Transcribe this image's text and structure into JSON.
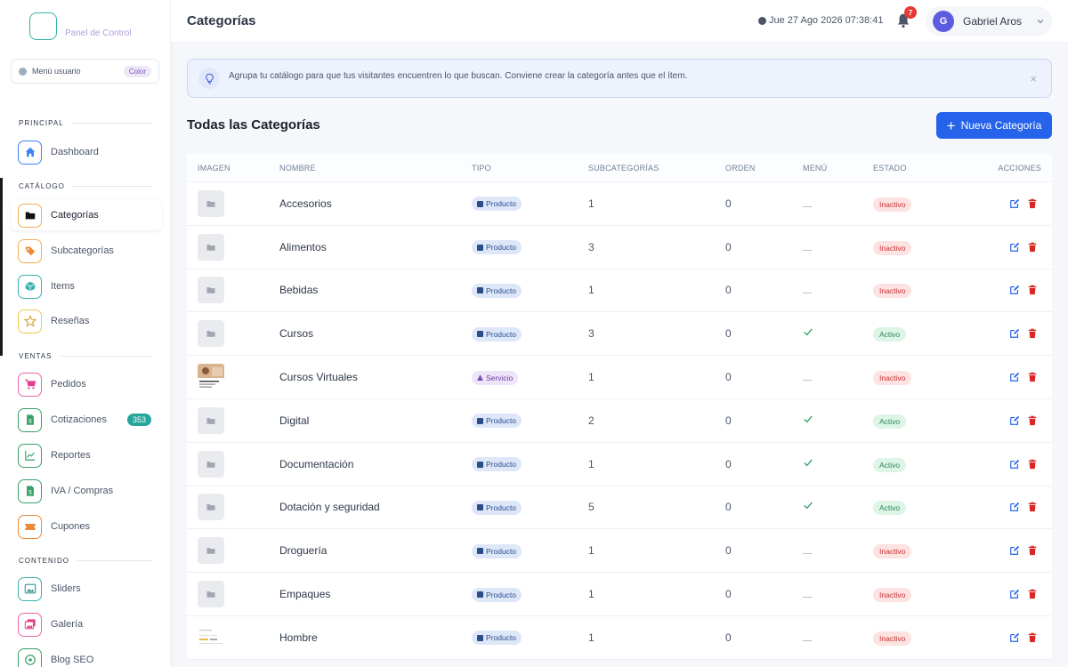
{
  "sidebar": {
    "logo_text": "Panel de Control",
    "menu_user": {
      "label": "Menú usuario",
      "color_badge": "Color"
    },
    "sections": [
      {
        "title": "PRINCIPAL",
        "items": [
          {
            "label": "Dashboard",
            "icon": "home-icon"
          }
        ]
      },
      {
        "title": "CATÁLOGO",
        "items": [
          {
            "label": "Categorías",
            "icon": "folder-icon",
            "active": true
          },
          {
            "label": "Subcategorías",
            "icon": "tags-icon"
          },
          {
            "label": "Items",
            "icon": "cube-icon"
          },
          {
            "label": "Reseñas",
            "icon": "star-icon"
          }
        ]
      },
      {
        "title": "VENTAS",
        "items": [
          {
            "label": "Pedidos",
            "icon": "cart-icon"
          },
          {
            "label": "Cotizaciones",
            "icon": "invoice-icon",
            "badge": "353"
          },
          {
            "label": "Reportes",
            "icon": "chart-line-icon"
          },
          {
            "label": "IVA / Compras",
            "icon": "receipt-icon"
          },
          {
            "label": "Cupones",
            "icon": "ticket-icon"
          }
        ]
      },
      {
        "title": "CONTENIDO",
        "items": [
          {
            "label": "Sliders",
            "icon": "image-icon"
          },
          {
            "label": "Galería",
            "icon": "images-icon"
          },
          {
            "label": "Blog SEO",
            "icon": "blog-icon"
          }
        ]
      }
    ]
  },
  "header": {
    "title": "Categorías",
    "datetime": "Jue 27 Ago 2026 07:38:41",
    "notifications": "7",
    "user": {
      "initial": "G",
      "name": "Gabriel Aros"
    }
  },
  "alert": {
    "text": "Agrupa tu catálogo para que tus visitantes encuentren lo que buscan. Conviene crear la categoría antes que el ítem.",
    "close": "×"
  },
  "content": {
    "heading": "Todas las Categorías",
    "new_button": "Nueva Categoría"
  },
  "table": {
    "columns": [
      "IMAGEN",
      "NOMBRE",
      "TIPO",
      "SUBCATEGORÍAS",
      "ORDEN",
      "MENÚ",
      "ESTADO",
      "ACCIONES"
    ],
    "rows": [
      {
        "nombre": "Accesorios",
        "tipo": "Producto",
        "sub": "1",
        "orden": "0",
        "menu": false,
        "estado": "Inactivo",
        "img": "placeholder"
      },
      {
        "nombre": "Alimentos",
        "tipo": "Producto",
        "sub": "3",
        "orden": "0",
        "menu": false,
        "estado": "Inactivo",
        "img": "placeholder"
      },
      {
        "nombre": "Bebidas",
        "tipo": "Producto",
        "sub": "1",
        "orden": "0",
        "menu": false,
        "estado": "Inactivo",
        "img": "placeholder"
      },
      {
        "nombre": "Cursos",
        "tipo": "Producto",
        "sub": "3",
        "orden": "0",
        "menu": true,
        "estado": "Activo",
        "img": "placeholder"
      },
      {
        "nombre": "Cursos Virtuales",
        "tipo": "Servicio",
        "sub": "1",
        "orden": "0",
        "menu": false,
        "estado": "Inactivo",
        "img": "photo"
      },
      {
        "nombre": "Digital",
        "tipo": "Producto",
        "sub": "2",
        "orden": "0",
        "menu": true,
        "estado": "Activo",
        "img": "placeholder"
      },
      {
        "nombre": "Documentación",
        "tipo": "Producto",
        "sub": "1",
        "orden": "0",
        "menu": true,
        "estado": "Activo",
        "img": "placeholder"
      },
      {
        "nombre": "Dotación y seguridad",
        "tipo": "Producto",
        "sub": "5",
        "orden": "0",
        "menu": true,
        "estado": "Activo",
        "img": "placeholder"
      },
      {
        "nombre": "Droguería",
        "tipo": "Producto",
        "sub": "1",
        "orden": "0",
        "menu": false,
        "estado": "Inactivo",
        "img": "placeholder"
      },
      {
        "nombre": "Empaques",
        "tipo": "Producto",
        "sub": "1",
        "orden": "0",
        "menu": false,
        "estado": "Inactivo",
        "img": "placeholder"
      },
      {
        "nombre": "Hombre",
        "tipo": "Producto",
        "sub": "1",
        "orden": "0",
        "menu": false,
        "estado": "Inactivo",
        "img": "document"
      }
    ]
  },
  "colors": {
    "primary": "#2563eb",
    "active_green": "#2f855a",
    "inactive_red": "#c53030",
    "edit_blue": "#2563eb",
    "delete_red": "#dc2626",
    "badge_teal": "#26a69a"
  }
}
